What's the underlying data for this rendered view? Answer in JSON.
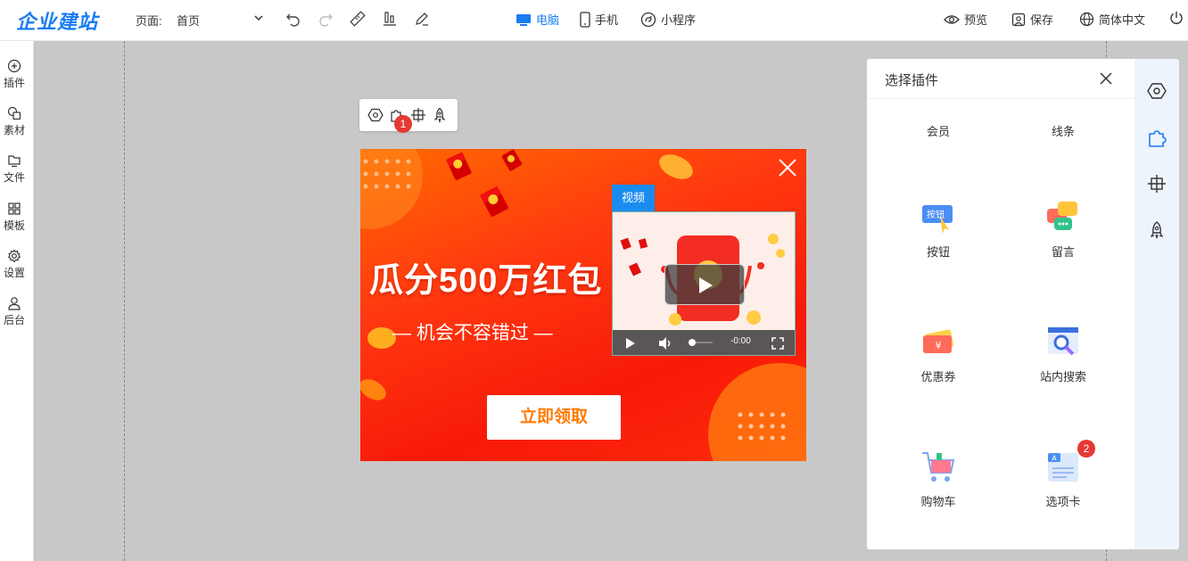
{
  "app": {
    "logo": "企业建站"
  },
  "header": {
    "page_label": "页面:",
    "page_value": "首页",
    "devices": [
      {
        "label": "电脑",
        "active": true
      },
      {
        "label": "手机",
        "active": false
      },
      {
        "label": "小程序",
        "active": false
      }
    ],
    "actions": {
      "preview": "预览",
      "save": "保存",
      "language": "简体中文"
    }
  },
  "sidebar": {
    "items": [
      {
        "label": "插件",
        "icon": "plus-circle-icon"
      },
      {
        "label": "素材",
        "icon": "material-icon"
      },
      {
        "label": "文件",
        "icon": "folder-icon"
      },
      {
        "label": "模板",
        "icon": "grid-icon"
      },
      {
        "label": "设置",
        "icon": "gear-icon"
      },
      {
        "label": "后台",
        "icon": "user-icon"
      }
    ]
  },
  "mini_toolbar": {
    "badge": "1"
  },
  "banner": {
    "title": "瓜分500万红包",
    "subtitle": "— 机会不容错过 —",
    "button": "立即领取",
    "video_tag": "视频",
    "video_time": "-0:00"
  },
  "panel": {
    "title": "选择插件",
    "plugins": [
      {
        "label": "会员"
      },
      {
        "label": "线条"
      },
      {
        "label": "按钮",
        "icon_text": "按钮"
      },
      {
        "label": "留言"
      },
      {
        "label": "优惠券"
      },
      {
        "label": "站内搜索"
      },
      {
        "label": "购物车"
      },
      {
        "label": "选项卡",
        "badge": "2"
      }
    ]
  },
  "colors": {
    "accent": "#1a7df0",
    "badge": "#e53935",
    "banner_btn_text": "#ff7a00"
  }
}
